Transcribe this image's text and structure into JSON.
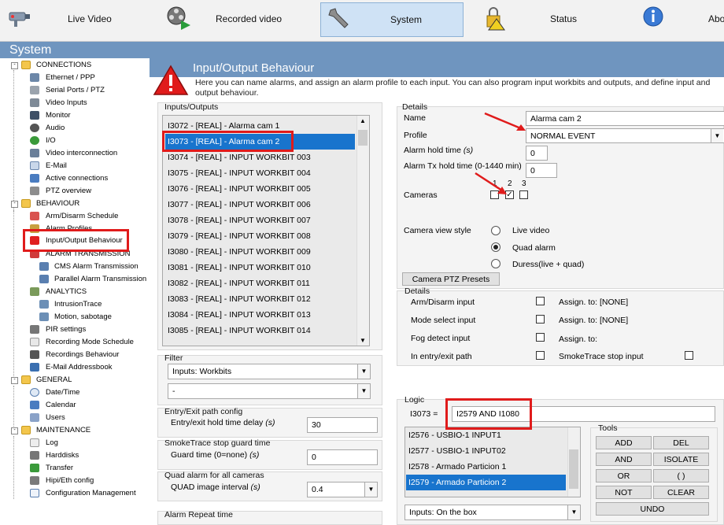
{
  "nav": {
    "live_video": "Live Video",
    "recorded_video": "Recorded video",
    "system": "System",
    "status": "Status",
    "about": "Abo"
  },
  "banner": {
    "title": "System"
  },
  "tree": {
    "connections": "CONNECTIONS",
    "ethernet": "Ethernet / PPP",
    "serial": "Serial Ports / PTZ",
    "video_inputs": "Video Inputs",
    "monitor": "Monitor",
    "audio": "Audio",
    "io": "I/O",
    "video_interconnection": "Video interconnection",
    "email": "E-Mail",
    "active_connections": "Active connections",
    "ptz_overview": "PTZ overview",
    "behaviour": "BEHAVIOUR",
    "arm_disarm": "Arm/Disarm Schedule",
    "alarm_profiles": "Alarm Profiles",
    "io_behaviour": "Input/Output Behaviour",
    "alarm_transmission": "ALARM TRANSMISSION",
    "cms_alarm": "CMS Alarm Transmission",
    "parallel_alarm": "Parallel Alarm Transmission",
    "analytics": "ANALYTICS",
    "intrusiontrace": "IntrusionTrace",
    "motion": "Motion, sabotage",
    "pir": "PIR settings",
    "recording_mode": "Recording Mode Schedule",
    "recordings_behaviour": "Recordings Behaviour",
    "email_addressbook": "E-Mail Addressbook",
    "general": "GENERAL",
    "date_time": "Date/Time",
    "calendar": "Calendar",
    "users": "Users",
    "maintenance": "MAINTENANCE",
    "log": "Log",
    "harddisks": "Harddisks",
    "transfer": "Transfer",
    "hipi": "Hipi/Eth config",
    "config_mgmt": "Configuration Management"
  },
  "header": {
    "title": "Input/Output Behaviour",
    "description": "Here you can name alarms, and assign an alarm profile to each input. You can also program input workbits and outputs, and define input and output behaviour."
  },
  "io_list": {
    "title": "Inputs/Outputs",
    "items": [
      "I3072 - [REAL] - Alarma cam 1",
      "I3073 - [REAL] - Alarma cam 2",
      "I3074 - [REAL] - INPUT WORKBIT 003",
      "I3075 - [REAL] - INPUT WORKBIT 004",
      "I3076 - [REAL] - INPUT WORKBIT 005",
      "I3077 - [REAL] - INPUT WORKBIT 006",
      "I3078 - [REAL] - INPUT WORKBIT 007",
      "I3079 - [REAL] - INPUT WORKBIT 008",
      "I3080 - [REAL] - INPUT WORKBIT 009",
      "I3081 - [REAL] - INPUT WORKBIT 010",
      "I3082 - [REAL] - INPUT WORKBIT 011",
      "I3083 - [REAL] - INPUT WORKBIT 012",
      "I3084 - [REAL] - INPUT WORKBIT 013",
      "I3085 - [REAL] - INPUT WORKBIT 014"
    ]
  },
  "filter": {
    "title": "Filter",
    "type_value": "Inputs: Workbits",
    "second_value": "-"
  },
  "entry_exit": {
    "title": "Entry/Exit path config",
    "label": "Entry/exit hold time delay",
    "unit": "(s)",
    "value": "30"
  },
  "smoketrace": {
    "title": "SmokeTrace stop guard time",
    "label": "Guard time (0=none)",
    "unit": "(s)",
    "value": "0"
  },
  "quad": {
    "title": "Quad alarm for all cameras",
    "label": "QUAD image interval",
    "unit": "(s)",
    "value": "0.4"
  },
  "alarm_repeat": {
    "title": "Alarm Repeat time"
  },
  "details": {
    "title": "Details",
    "name_label": "Name",
    "name_value": "Alarma cam 2",
    "profile_label": "Profile",
    "profile_value": "NORMAL EVENT",
    "hold_label": "Alarm hold time",
    "hold_unit": "(s)",
    "hold_value": "0",
    "tx_label": "Alarm Tx hold time",
    "tx_unit": "(0-1440 min)",
    "tx_value": "0",
    "cameras_label": "Cameras",
    "cam1": "1",
    "cam2": "2",
    "cam3": "3",
    "cam_check2": "✓",
    "view_style_label": "Camera view style",
    "opt_live": "Live video",
    "opt_quad": "Quad alarm",
    "opt_duress": "Duress(live + quad)",
    "ptz_button": "Camera PTZ Presets"
  },
  "details2": {
    "title": "Details",
    "arm_disarm": "Arm/Disarm input",
    "mode_select": "Mode select input",
    "fog_detect": "Fog detect input",
    "entry_exit": "In entry/exit path",
    "assign1": "Assign. to: [NONE]",
    "assign2": "Assign. to: [NONE]",
    "assign3": "Assign. to:",
    "smoketrace_stop": "SmokeTrace stop input"
  },
  "logic": {
    "title": "Logic",
    "id_label": "I3073 =",
    "expression": "I2579 AND I1080",
    "items": [
      "I2576 - USBIO-1 INPUT1",
      "I2577 - USBIO-1 INPUT02",
      "I2578 - Armado Particion 1",
      "I2579 - Armado Particion 2"
    ],
    "source_value": "Inputs: On the box"
  },
  "tools": {
    "title": "Tools",
    "add": "ADD",
    "del": "DEL",
    "and": "AND",
    "isolate": "ISOLATE",
    "or": "OR",
    "parens": "( )",
    "not": "NOT",
    "clear": "CLEAR",
    "undo": "UNDO"
  },
  "colors": {
    "accent": "#6f95bf",
    "highlight": "#1874cd",
    "annotation": "#e01b1b"
  }
}
